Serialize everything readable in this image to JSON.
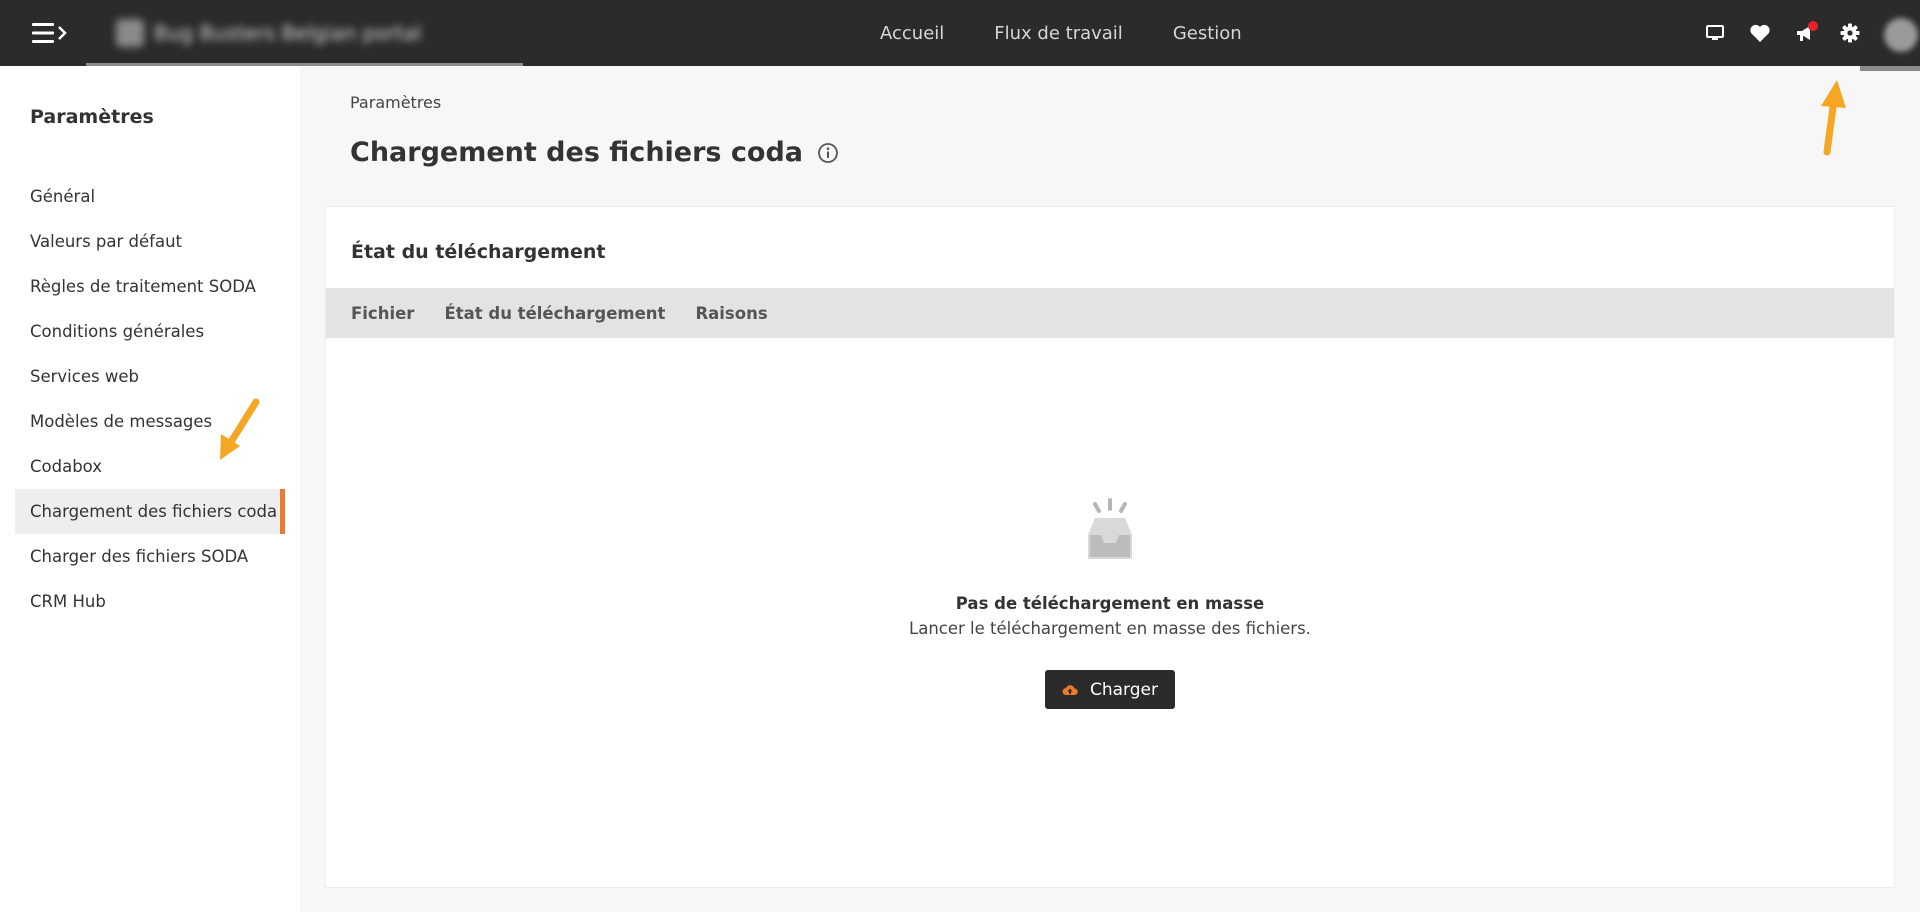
{
  "header": {
    "portal_name": "Bug Busters Belgian portal",
    "nav": [
      "Accueil",
      "Flux de travail",
      "Gestion"
    ],
    "icons": [
      "monitor-icon",
      "heart-icon",
      "megaphone-icon",
      "gear-icon"
    ]
  },
  "sidebar": {
    "title": "Paramètres",
    "items": [
      {
        "label": "Général"
      },
      {
        "label": "Valeurs par défaut"
      },
      {
        "label": "Règles de traitement SODA"
      },
      {
        "label": "Conditions générales"
      },
      {
        "label": "Services web"
      },
      {
        "label": "Modèles de messages"
      },
      {
        "label": "Codabox"
      },
      {
        "label": "Chargement des fichiers coda"
      },
      {
        "label": "Charger des fichiers SODA"
      },
      {
        "label": "CRM Hub"
      }
    ],
    "active_index": 7
  },
  "main": {
    "breadcrumb": "Paramètres",
    "title": "Chargement des fichiers coda",
    "card": {
      "title": "État du téléchargement",
      "columns": [
        "Fichier",
        "État du téléchargement",
        "Raisons"
      ],
      "empty_title": "Pas de téléchargement en masse",
      "empty_subtitle": "Lancer le téléchargement en masse des fichiers.",
      "upload_label": "Charger"
    }
  },
  "colors": {
    "topbar": "#2b2b2b",
    "accent": "#ea7a2c",
    "annotation_arrow": "#f5a623"
  }
}
